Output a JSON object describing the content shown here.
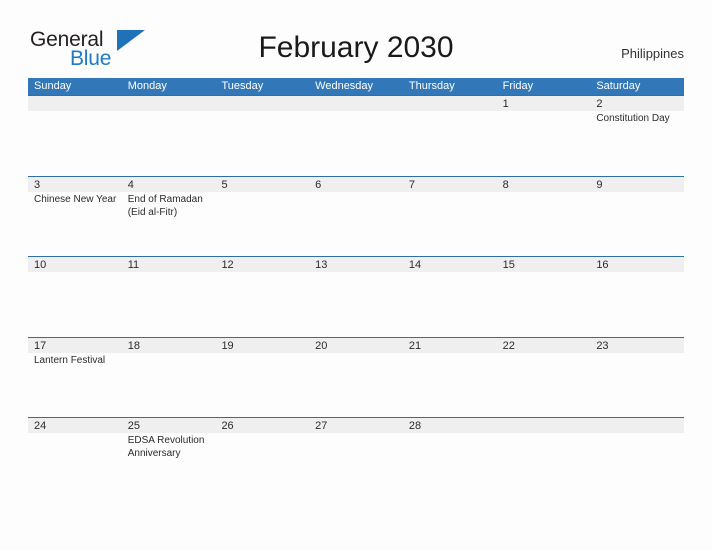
{
  "logo": {
    "text_top": "General",
    "text_bottom": "Blue",
    "accent_color": "#1f7ac4"
  },
  "header": {
    "title": "February 2030",
    "country": "Philippines"
  },
  "calendar": {
    "header_bg": "#3277b8",
    "row_border": "#2f6fa8",
    "band_bg": "#efefef",
    "day_names": [
      "Sunday",
      "Monday",
      "Tuesday",
      "Wednesday",
      "Thursday",
      "Friday",
      "Saturday"
    ],
    "weeks": [
      [
        {
          "num": "",
          "event": []
        },
        {
          "num": "",
          "event": []
        },
        {
          "num": "",
          "event": []
        },
        {
          "num": "",
          "event": []
        },
        {
          "num": "",
          "event": []
        },
        {
          "num": "1",
          "event": []
        },
        {
          "num": "2",
          "event": [
            "Constitution Day"
          ]
        }
      ],
      [
        {
          "num": "3",
          "event": [
            "Chinese New Year"
          ]
        },
        {
          "num": "4",
          "event": [
            "End of Ramadan",
            "(Eid al-Fitr)"
          ]
        },
        {
          "num": "5",
          "event": []
        },
        {
          "num": "6",
          "event": []
        },
        {
          "num": "7",
          "event": []
        },
        {
          "num": "8",
          "event": []
        },
        {
          "num": "9",
          "event": []
        }
      ],
      [
        {
          "num": "10",
          "event": []
        },
        {
          "num": "11",
          "event": []
        },
        {
          "num": "12",
          "event": []
        },
        {
          "num": "13",
          "event": []
        },
        {
          "num": "14",
          "event": []
        },
        {
          "num": "15",
          "event": []
        },
        {
          "num": "16",
          "event": []
        }
      ],
      [
        {
          "num": "17",
          "event": [
            "Lantern Festival"
          ]
        },
        {
          "num": "18",
          "event": []
        },
        {
          "num": "19",
          "event": []
        },
        {
          "num": "20",
          "event": []
        },
        {
          "num": "21",
          "event": []
        },
        {
          "num": "22",
          "event": []
        },
        {
          "num": "23",
          "event": []
        }
      ],
      [
        {
          "num": "24",
          "event": []
        },
        {
          "num": "25",
          "event": [
            "EDSA Revolution",
            "Anniversary"
          ]
        },
        {
          "num": "26",
          "event": []
        },
        {
          "num": "27",
          "event": []
        },
        {
          "num": "28",
          "event": []
        },
        {
          "num": "",
          "event": []
        },
        {
          "num": "",
          "event": []
        }
      ]
    ]
  }
}
